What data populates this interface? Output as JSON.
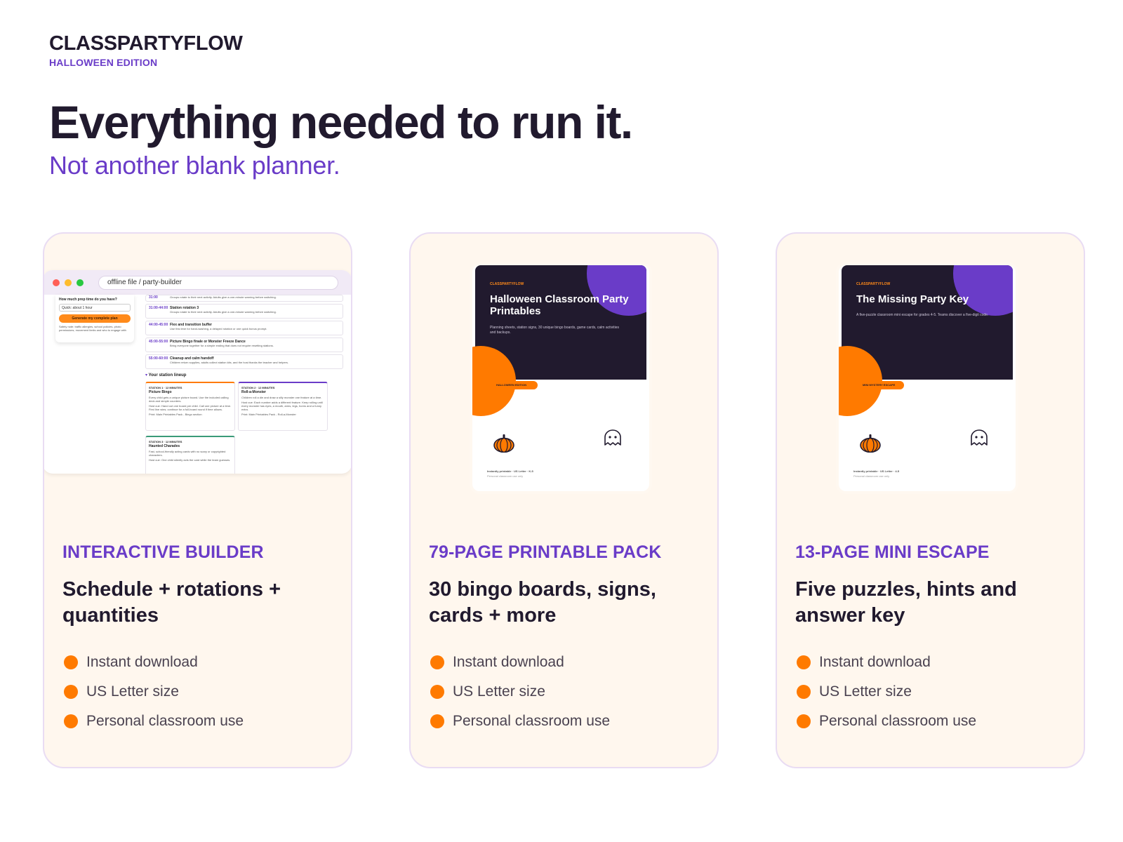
{
  "brand": {
    "name": "CLASSPARTYFLOW",
    "edition": "HALLOWEEN EDITION"
  },
  "hero": {
    "title": "Everything needed to run it.",
    "subtitle": "Not another blank planner."
  },
  "colors": {
    "purple": "#6a3cc8",
    "orange": "#ff7a00",
    "dark": "#211a2e",
    "card_bg": "#fff7ee"
  },
  "cards": [
    {
      "kicker": "INTERACTIVE BUILDER",
      "title": "Schedule + rotations + quantities",
      "features": [
        "Instant download",
        "US Letter size",
        "Personal classroom use"
      ],
      "mock": {
        "url": "offline file / party-builder",
        "prep_question": "How much prep time do you have?",
        "prep_value": "Quick: about 1 hour",
        "generate_label": "Generate my complete plan",
        "side_note": "Safety note: traffic allergies, school policies, photo permissions, movement limits and who to engage with the classroom teacher before the party.",
        "rows": [
          {
            "time": "31:00",
            "title": "",
            "desc": "Groups rotate to their next activity. Adults give a one-minute warning before switching."
          },
          {
            "time": "31:00-44:00",
            "title": "Station rotation 3",
            "desc": "Groups rotate to their next activity. Adults give a one-minute warning before switching."
          },
          {
            "time": "44:00-45:00",
            "title": "Flex and transition buffer",
            "desc": "Use this time for hand-washing, a delayed rotation or one quick bonus prompt."
          },
          {
            "time": "45:00-55:00",
            "title": "Picture Bingo finale or Monster Freeze Dance",
            "desc": "Bring everyone together for a simple ending that does not require resetting stations."
          },
          {
            "time": "55:00-60:00",
            "title": "Cleanup and calm handoff",
            "desc": "Children return supplies, adults collect station kits, and the host thanks the teacher and helpers."
          }
        ],
        "lineup_label": "Your station lineup",
        "stations": [
          {
            "tag": "STATION 1 · 12 MINUTES",
            "name": "Picture Bingo",
            "desc": "Every child gets a unique picture board. Use the included calling deck and simple counters.",
            "host": "Host cue: Hand out one board per child. Call one picture at a time. First line wins; continue for a full-board round if time allows.",
            "print": "Print: Main Printables Pack - Bingo section"
          },
          {
            "tag": "STATION 2 · 12 MINUTES",
            "name": "Roll-a-Monster",
            "desc": "Children roll a die and draw a silly monster one feature at a time.",
            "host": "Host cue: Each number adds a different feature. Keep rolling until every monster has eyes, a mouth, arms, legs, horns and a funny extra.",
            "print": "Print: Main Printables Pack - Roll-a-Monster"
          },
          {
            "tag": "STATION 3 · 12 MINUTES",
            "name": "Haunted Charades",
            "desc": "Fast, school-friendly acting cards with no scary or copyrighted characters.",
            "host": "Host cue: One child silently acts the card while the team guesses."
          }
        ]
      }
    },
    {
      "kicker": "79-PAGE PRINTABLE PACK",
      "title": "30 bingo boards, signs, cards + more",
      "features": [
        "Instant download",
        "US Letter size",
        "Personal classroom use"
      ],
      "cover": {
        "brand": "CLASSPARTYFLOW",
        "title": "Halloween Classroom Party Printables",
        "desc": "Planning sheets, station signs, 30 unique bingo boards, game cards, calm activities and backups.",
        "pill": "HALLOWEEN EDITION",
        "foot1": "Instantly printable · US Letter · K-5",
        "foot2": "Personal classroom use only"
      }
    },
    {
      "kicker": "13-PAGE MINI ESCAPE",
      "title": "Five puzzles, hints and answer key",
      "features": [
        "Instant download",
        "US Letter size",
        "Personal classroom use"
      ],
      "cover": {
        "brand": "CLASSPARTYFLOW",
        "title": "The Missing Party Key",
        "desc": "A five-puzzle classroom mini escape for grades 4-5. Teams discover a five-digit code.",
        "pill": "MINI MYSTERY ESCAPE",
        "foot1": "Instantly printable · US Letter · 4-5",
        "foot2": "Personal classroom use only"
      }
    }
  ]
}
